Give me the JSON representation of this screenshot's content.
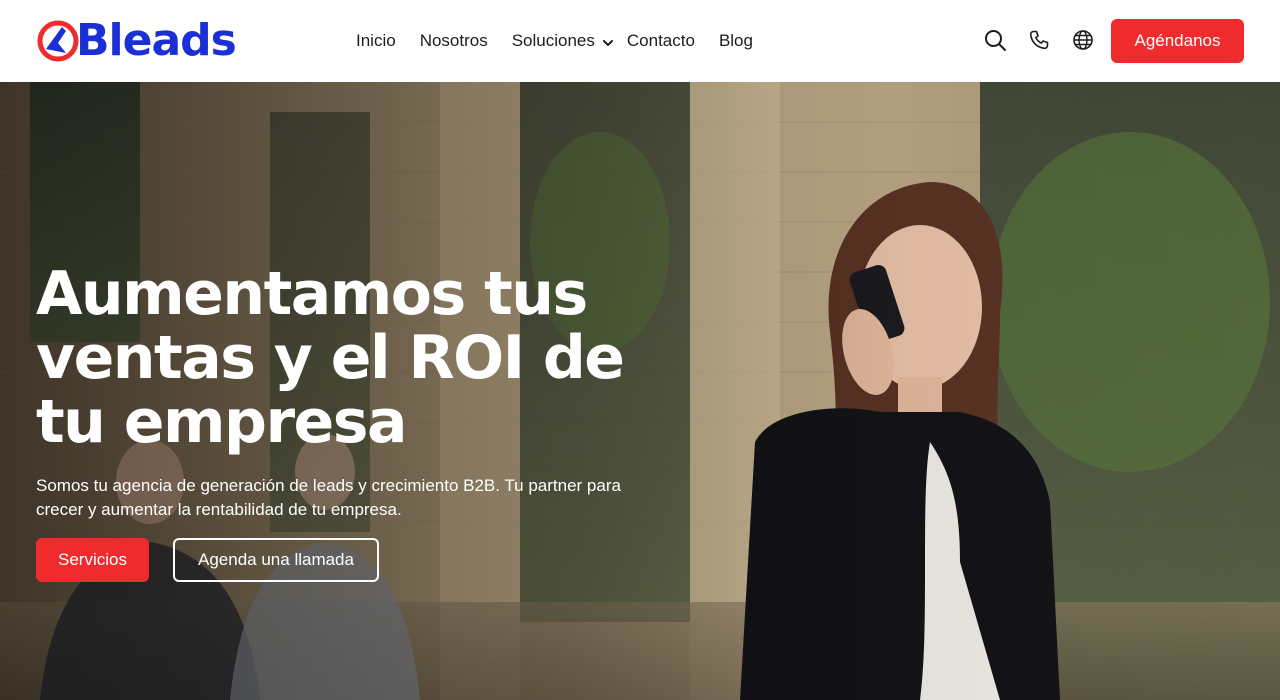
{
  "brand": {
    "name": "Bleads",
    "color": "#1a2fd6",
    "accent": "#ef2b2d"
  },
  "nav": {
    "items": [
      "Inicio",
      "Nosotros",
      "Soluciones",
      "Contacto",
      "Blog"
    ],
    "dropdown_icon": "chevron-down-icon"
  },
  "tools": {
    "icons": [
      "search-icon",
      "phone-icon",
      "globe-icon"
    ]
  },
  "header": {
    "cta_label": "Agéndanos"
  },
  "hero": {
    "title": "Aumentamos tus ventas y el ROI de tu empresa",
    "subtitle": "Somos tu agencia de generación de leads y crecimiento B2B. Tu partner para crecer y aumentar la rentabilidad de tu empresa.",
    "primary_button": "Servicios",
    "secondary_button": "Agenda una llamada",
    "background": "photo: woman on phone and two men in front of a brick building"
  }
}
